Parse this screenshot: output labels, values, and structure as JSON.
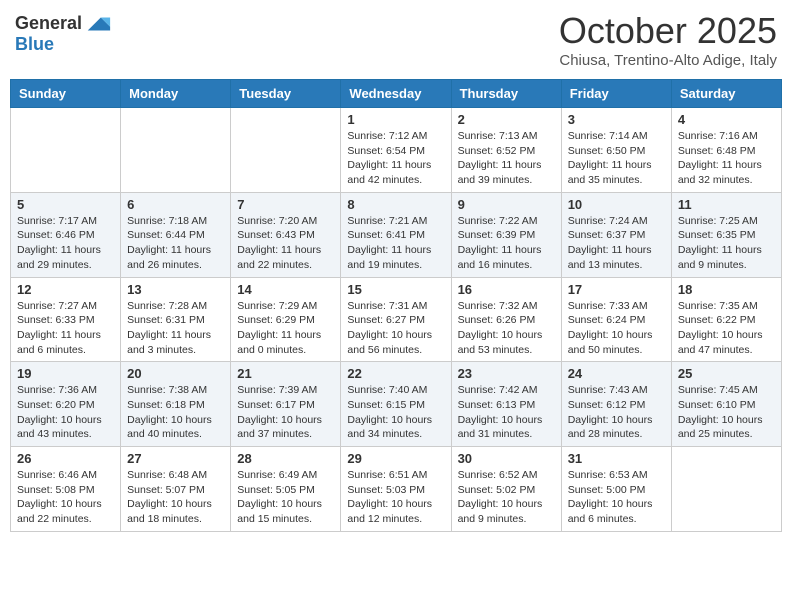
{
  "header": {
    "logo_line1": "General",
    "logo_line2": "Blue",
    "month": "October 2025",
    "location": "Chiusa, Trentino-Alto Adige, Italy"
  },
  "weekdays": [
    "Sunday",
    "Monday",
    "Tuesday",
    "Wednesday",
    "Thursday",
    "Friday",
    "Saturday"
  ],
  "weeks": [
    [
      {
        "day": "",
        "info": ""
      },
      {
        "day": "",
        "info": ""
      },
      {
        "day": "",
        "info": ""
      },
      {
        "day": "1",
        "info": "Sunrise: 7:12 AM\nSunset: 6:54 PM\nDaylight: 11 hours and 42 minutes."
      },
      {
        "day": "2",
        "info": "Sunrise: 7:13 AM\nSunset: 6:52 PM\nDaylight: 11 hours and 39 minutes."
      },
      {
        "day": "3",
        "info": "Sunrise: 7:14 AM\nSunset: 6:50 PM\nDaylight: 11 hours and 35 minutes."
      },
      {
        "day": "4",
        "info": "Sunrise: 7:16 AM\nSunset: 6:48 PM\nDaylight: 11 hours and 32 minutes."
      }
    ],
    [
      {
        "day": "5",
        "info": "Sunrise: 7:17 AM\nSunset: 6:46 PM\nDaylight: 11 hours and 29 minutes."
      },
      {
        "day": "6",
        "info": "Sunrise: 7:18 AM\nSunset: 6:44 PM\nDaylight: 11 hours and 26 minutes."
      },
      {
        "day": "7",
        "info": "Sunrise: 7:20 AM\nSunset: 6:43 PM\nDaylight: 11 hours and 22 minutes."
      },
      {
        "day": "8",
        "info": "Sunrise: 7:21 AM\nSunset: 6:41 PM\nDaylight: 11 hours and 19 minutes."
      },
      {
        "day": "9",
        "info": "Sunrise: 7:22 AM\nSunset: 6:39 PM\nDaylight: 11 hours and 16 minutes."
      },
      {
        "day": "10",
        "info": "Sunrise: 7:24 AM\nSunset: 6:37 PM\nDaylight: 11 hours and 13 minutes."
      },
      {
        "day": "11",
        "info": "Sunrise: 7:25 AM\nSunset: 6:35 PM\nDaylight: 11 hours and 9 minutes."
      }
    ],
    [
      {
        "day": "12",
        "info": "Sunrise: 7:27 AM\nSunset: 6:33 PM\nDaylight: 11 hours and 6 minutes."
      },
      {
        "day": "13",
        "info": "Sunrise: 7:28 AM\nSunset: 6:31 PM\nDaylight: 11 hours and 3 minutes."
      },
      {
        "day": "14",
        "info": "Sunrise: 7:29 AM\nSunset: 6:29 PM\nDaylight: 11 hours and 0 minutes."
      },
      {
        "day": "15",
        "info": "Sunrise: 7:31 AM\nSunset: 6:27 PM\nDaylight: 10 hours and 56 minutes."
      },
      {
        "day": "16",
        "info": "Sunrise: 7:32 AM\nSunset: 6:26 PM\nDaylight: 10 hours and 53 minutes."
      },
      {
        "day": "17",
        "info": "Sunrise: 7:33 AM\nSunset: 6:24 PM\nDaylight: 10 hours and 50 minutes."
      },
      {
        "day": "18",
        "info": "Sunrise: 7:35 AM\nSunset: 6:22 PM\nDaylight: 10 hours and 47 minutes."
      }
    ],
    [
      {
        "day": "19",
        "info": "Sunrise: 7:36 AM\nSunset: 6:20 PM\nDaylight: 10 hours and 43 minutes."
      },
      {
        "day": "20",
        "info": "Sunrise: 7:38 AM\nSunset: 6:18 PM\nDaylight: 10 hours and 40 minutes."
      },
      {
        "day": "21",
        "info": "Sunrise: 7:39 AM\nSunset: 6:17 PM\nDaylight: 10 hours and 37 minutes."
      },
      {
        "day": "22",
        "info": "Sunrise: 7:40 AM\nSunset: 6:15 PM\nDaylight: 10 hours and 34 minutes."
      },
      {
        "day": "23",
        "info": "Sunrise: 7:42 AM\nSunset: 6:13 PM\nDaylight: 10 hours and 31 minutes."
      },
      {
        "day": "24",
        "info": "Sunrise: 7:43 AM\nSunset: 6:12 PM\nDaylight: 10 hours and 28 minutes."
      },
      {
        "day": "25",
        "info": "Sunrise: 7:45 AM\nSunset: 6:10 PM\nDaylight: 10 hours and 25 minutes."
      }
    ],
    [
      {
        "day": "26",
        "info": "Sunrise: 6:46 AM\nSunset: 5:08 PM\nDaylight: 10 hours and 22 minutes."
      },
      {
        "day": "27",
        "info": "Sunrise: 6:48 AM\nSunset: 5:07 PM\nDaylight: 10 hours and 18 minutes."
      },
      {
        "day": "28",
        "info": "Sunrise: 6:49 AM\nSunset: 5:05 PM\nDaylight: 10 hours and 15 minutes."
      },
      {
        "day": "29",
        "info": "Sunrise: 6:51 AM\nSunset: 5:03 PM\nDaylight: 10 hours and 12 minutes."
      },
      {
        "day": "30",
        "info": "Sunrise: 6:52 AM\nSunset: 5:02 PM\nDaylight: 10 hours and 9 minutes."
      },
      {
        "day": "31",
        "info": "Sunrise: 6:53 AM\nSunset: 5:00 PM\nDaylight: 10 hours and 6 minutes."
      },
      {
        "day": "",
        "info": ""
      }
    ]
  ]
}
